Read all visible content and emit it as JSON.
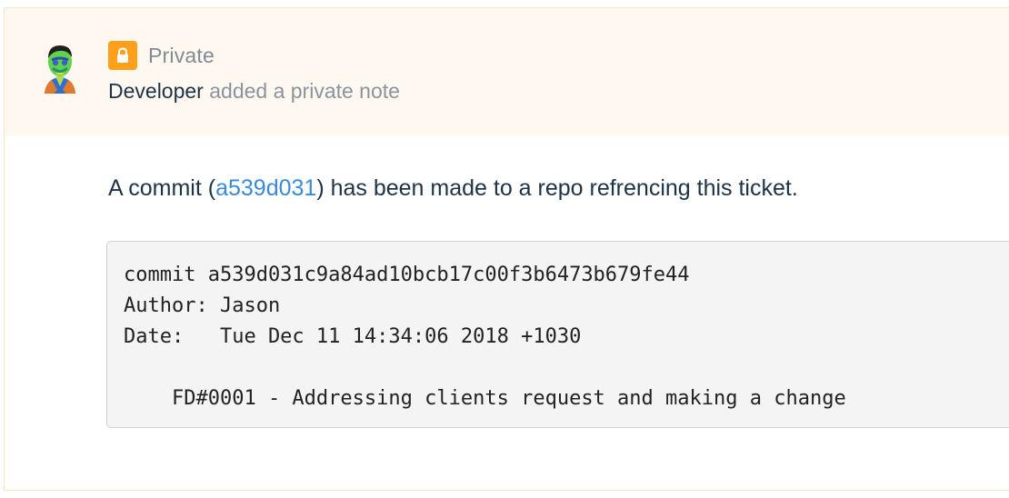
{
  "note": {
    "visibility_label": "Private",
    "author": "Developer",
    "action_text": " added a private note"
  },
  "message": {
    "prefix": "A commit (",
    "commit_link_text": "a539d031",
    "suffix": ") has been made to a repo refrencing this ticket."
  },
  "commit_block": {
    "lines": [
      "commit a539d031c9a84ad10bcb17c00f3b6473b679fe44",
      "Author: Jason",
      "Date:   Tue Dec 11 14:34:06 2018 +1030",
      "",
      "    FD#0001 - Addressing clients request and making a change"
    ]
  },
  "colors": {
    "header_background": "#fff8f1",
    "lock_badge": "#ff9f1a",
    "link": "#3a8ad9",
    "primary_text": "#1d3346"
  },
  "icons": {
    "lock": "lock-icon",
    "avatar": "avatar"
  }
}
